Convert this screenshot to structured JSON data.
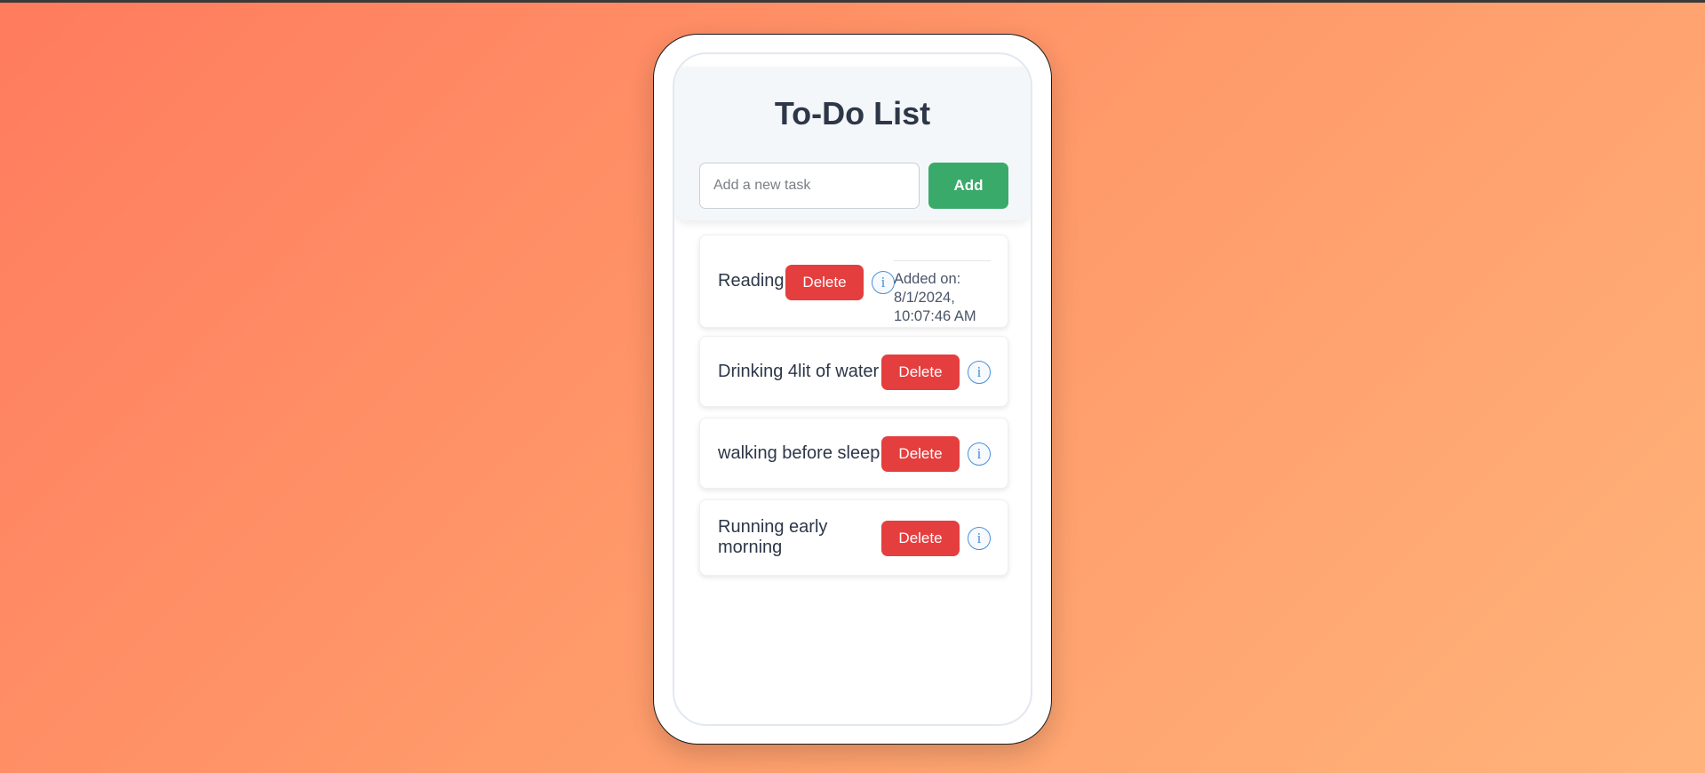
{
  "app": {
    "title": "To-Do List",
    "input_placeholder": "Add a new task",
    "input_value": "",
    "add_label": "Add"
  },
  "tasks": [
    {
      "text": "Reading",
      "delete_label": "Delete",
      "info_glyph": "i",
      "info_open": true,
      "info_text": "Added on: 8/1/2024, 10:07:46 AM"
    },
    {
      "text": "Drinking 4lit of water",
      "delete_label": "Delete",
      "info_glyph": "i",
      "info_open": false
    },
    {
      "text": "walking before sleep",
      "delete_label": "Delete",
      "info_glyph": "i",
      "info_open": false
    },
    {
      "text": "Running early morning",
      "delete_label": "Delete",
      "info_glyph": "i",
      "info_open": false
    }
  ],
  "colors": {
    "add_button": "#3aaa6a",
    "delete_button": "#e53e3e",
    "info_icon": "#4a90d9",
    "title_text": "#2d3748"
  },
  "icons": {
    "info": "info-circle-icon"
  }
}
